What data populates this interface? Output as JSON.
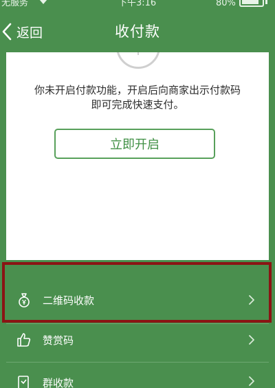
{
  "status_bar": {
    "carrier": "无服务",
    "time": "下午3:16",
    "battery": "80%"
  },
  "nav": {
    "back_label": "返回",
    "title": "收付款"
  },
  "card": {
    "description_line1": "你未开启付款功能，开启后向商家出示付款码",
    "description_line2": "即可完成快速支付。",
    "enable_button_label": "立即开启"
  },
  "menu": [
    {
      "label": "二维码收款",
      "icon": "money-bag-icon"
    },
    {
      "label": "赞赏码",
      "icon": "thumbs-up-icon"
    },
    {
      "label": "群收款",
      "icon": "group-collect-icon"
    }
  ],
  "colors": {
    "brand_green": "#4a8f4e",
    "button_green": "#3f8f43",
    "highlight_red": "#8a1414"
  }
}
